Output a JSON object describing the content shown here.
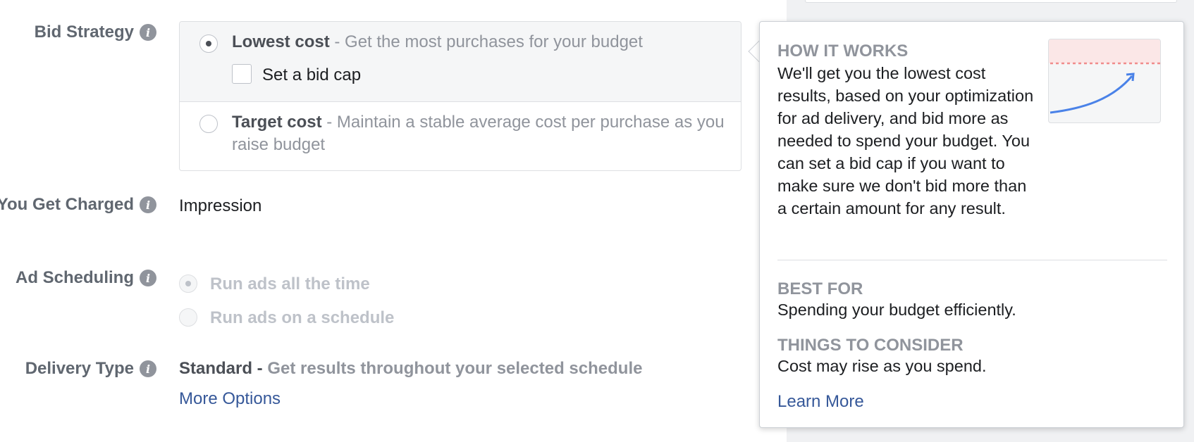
{
  "labels": {
    "bid_strategy": "Bid Strategy",
    "charged": "You Get Charged",
    "scheduling": "Ad Scheduling",
    "delivery_type": "Delivery Type"
  },
  "bid_strategy": {
    "options": [
      {
        "title": "Lowest cost",
        "desc": " - Get the most purchases for your budget",
        "checked": true
      },
      {
        "title": "Target cost",
        "desc": " - Maintain a stable average cost per purchase as you raise budget",
        "checked": false
      }
    ],
    "bid_cap_label": "Set a bid cap"
  },
  "charged": {
    "value": "Impression"
  },
  "scheduling": {
    "options": [
      {
        "label": "Run ads all the time",
        "checked": true
      },
      {
        "label": "Run ads on a schedule",
        "checked": false
      }
    ]
  },
  "delivery": {
    "strong": "Standard -",
    "desc": " Get results throughout your selected schedule",
    "more_options": "More Options"
  },
  "tooltip": {
    "how_heading": "HOW IT WORKS",
    "how_body": "We'll get you the lowest cost results, based on your optimization for ad delivery, and bid more as needed to spend your budget. You can set a bid cap if you want to make sure we don't bid more than a certain amount for any result.",
    "best_heading": "BEST FOR",
    "best_body": "Spending your budget efficiently.",
    "consider_heading": "THINGS TO CONSIDER",
    "consider_body": "Cost may rise as you spend.",
    "learn_more": "Learn More"
  },
  "colors": {
    "link": "#365899",
    "graph_line": "#4a82e8",
    "graph_cap": "#f08c8c"
  },
  "icons": {
    "info": "info-icon",
    "graph": "bid-cap-graph-icon"
  }
}
